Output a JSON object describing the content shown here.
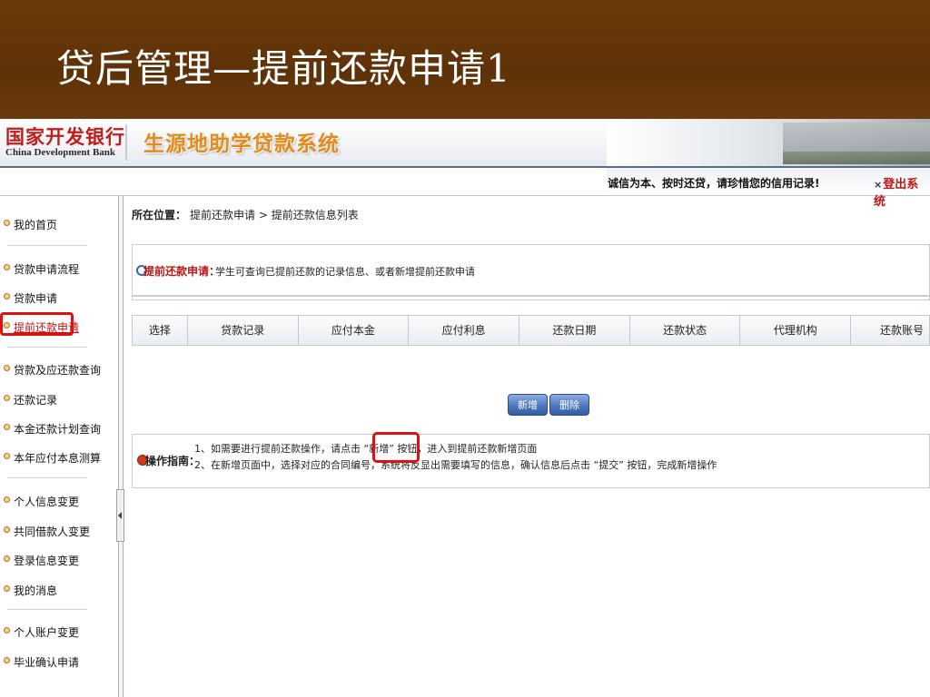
{
  "slide": {
    "title": "贷后管理—提前还款申请1"
  },
  "banner": {
    "logo_cn": "国家开发银行",
    "logo_en": "China Development Bank",
    "system_title": "生源地助学贷款系统"
  },
  "topbar": {
    "slogan": "诚信为本、按时还贷，请珍惜您的信用记录!",
    "logout": "登出系统"
  },
  "sidebar": {
    "items": [
      {
        "label": "我的首页"
      },
      {
        "label": "贷款申请流程"
      },
      {
        "label": "贷款申请"
      },
      {
        "label": "提前还款申请"
      },
      {
        "label": "贷款及应还款查询"
      },
      {
        "label": "还款记录"
      },
      {
        "label": "本金还款计划查询"
      },
      {
        "label": "本年应付本息测算"
      },
      {
        "label": "个人信息变更"
      },
      {
        "label": "共同借款人变更"
      },
      {
        "label": "登录信息变更"
      },
      {
        "label": "我的消息"
      },
      {
        "label": "个人账户变更"
      },
      {
        "label": "毕业确认申请"
      }
    ],
    "active_index": 3
  },
  "breadcrumb": {
    "label": "所在位置：",
    "path": "提前还款申请 > 提前还款信息列表"
  },
  "intro": {
    "label": "提前还款申请：",
    "text": "学生可查询已提前还款的记录信息、或者新增提前还款申请"
  },
  "table": {
    "columns": [
      "选择",
      "贷款记录",
      "应付本金",
      "应付利息",
      "还款日期",
      "还款状态",
      "代理机构",
      "还款账号"
    ]
  },
  "actions": {
    "add": "新增",
    "delete": "删除"
  },
  "guide": {
    "label": "操作指南：",
    "lines": [
      "1、如需要进行提前还款操作，请点击 “新增” 按钮，进入到提前还款新增页面",
      "2、在新增页面中，选择对应的合同编号，系统将反显出需要填写的信息，确认信息后点击 “提交” 按钮，完成新增操作"
    ]
  },
  "colors": {
    "title_bar": "#6b3a0a",
    "accent_red": "#c01515",
    "system_orange": "#e38b1d",
    "button_blue": "#4d77bf",
    "highlight_red": "#e01010"
  }
}
